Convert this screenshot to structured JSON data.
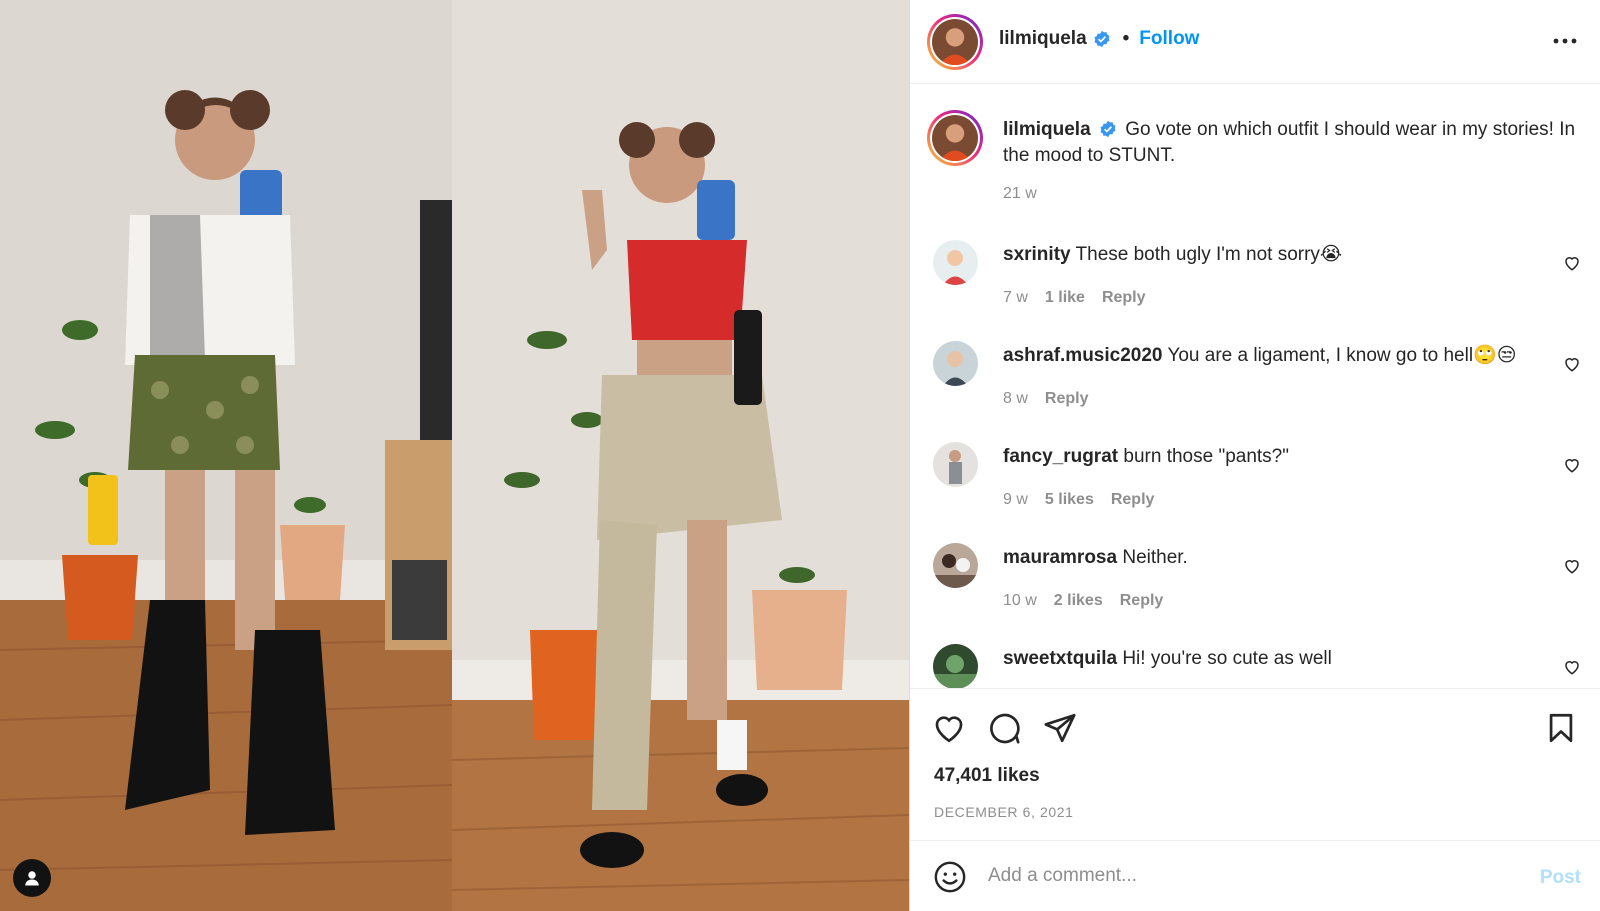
{
  "post": {
    "username": "lilmiquela",
    "verified": true,
    "follow_label": "Follow",
    "more_icon": "more-horizontal-icon",
    "caption": "Go vote on which outfit I should wear in my stories! In the mood to STUNT.",
    "caption_time": "21 w",
    "likes": "47,401 likes",
    "date": "DECEMBER 6, 2021"
  },
  "comments": [
    {
      "username": "sxrinity",
      "text": "These both ugly I'm not sorry😭",
      "time": "7 w",
      "likes": "1 like",
      "reply": "Reply"
    },
    {
      "username": "ashraf.music2020",
      "text": "You are a ligament, I know go to hell🙄😒",
      "time": "8 w",
      "likes": "",
      "reply": "Reply"
    },
    {
      "username": "fancy_rugrat",
      "text": "burn those \"pants?\"",
      "time": "9 w",
      "likes": "5 likes",
      "reply": "Reply"
    },
    {
      "username": "mauramrosa",
      "text": "Neither.",
      "time": "10 w",
      "likes": "2 likes",
      "reply": "Reply"
    },
    {
      "username": "sweetxtquila",
      "text": "Hi! you're so cute as well",
      "time": "",
      "likes": "",
      "reply": ""
    }
  ],
  "composer": {
    "placeholder": "Add a comment...",
    "post_label": "Post"
  },
  "colors": {
    "accent": "#0095f6",
    "post_disabled": "#b2dffc",
    "muted": "#8e8e8e",
    "text": "#262626"
  },
  "icons": [
    "heart-icon",
    "comment-icon",
    "share-icon",
    "bookmark-icon",
    "emoji-icon",
    "user-tag-icon",
    "verified-badge-icon"
  ]
}
